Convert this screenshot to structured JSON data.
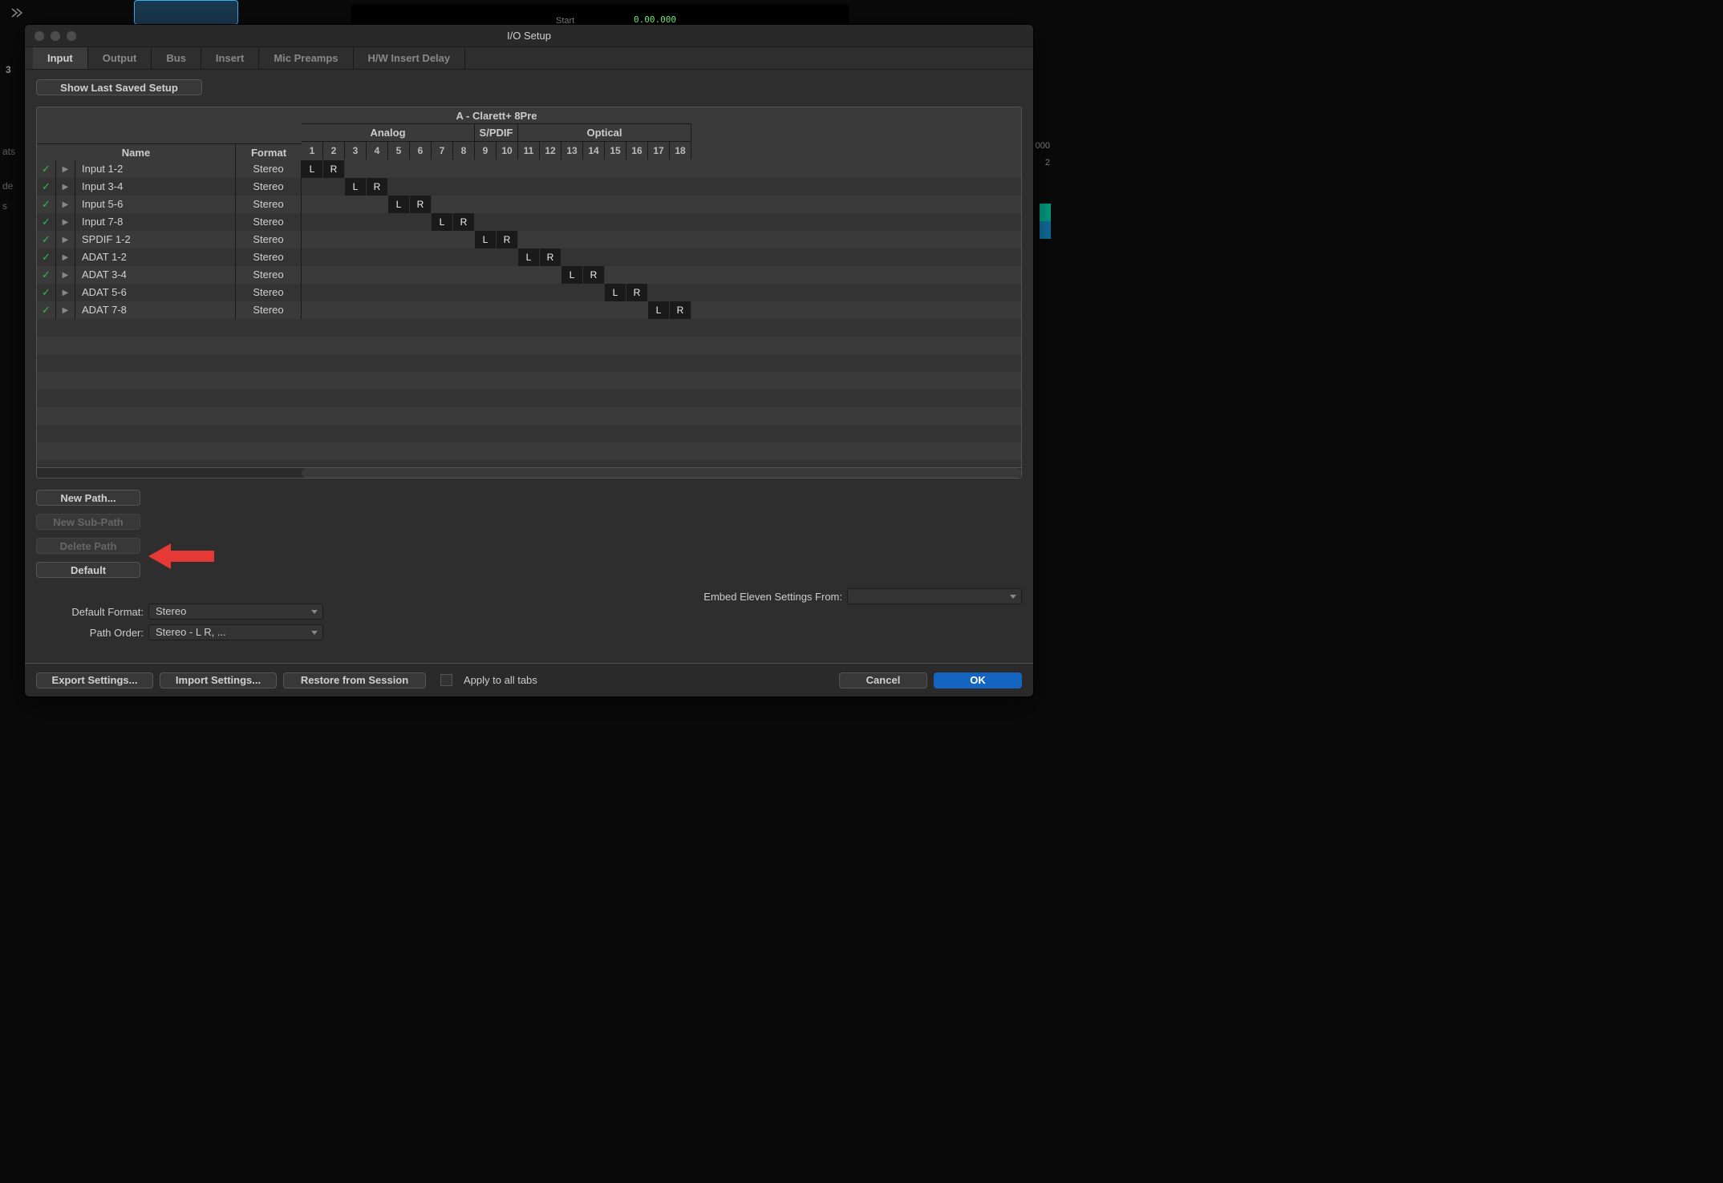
{
  "background": {
    "tab_number": "3",
    "sidebar1": "ats",
    "sidebar2": "de",
    "sidebar3": "s",
    "start": "Start",
    "right_text": "2",
    "counter1": "0.00.000",
    "right_zero": "000"
  },
  "modal": {
    "title": "I/O Setup",
    "tabs": [
      "Input",
      "Output",
      "Bus",
      "Insert",
      "Mic Preamps",
      "H/W Insert Delay"
    ],
    "active_tab": "Input",
    "show_last_saved": "Show Last Saved Setup",
    "device": "A - Clarett+ 8Pre",
    "sections": [
      {
        "label": "Analog",
        "span": 8
      },
      {
        "label": "S/PDIF",
        "span": 2
      },
      {
        "label": "Optical",
        "span": 8
      }
    ],
    "channels": [
      "1",
      "2",
      "3",
      "4",
      "5",
      "6",
      "7",
      "8",
      "9",
      "10",
      "11",
      "12",
      "13",
      "14",
      "15",
      "16",
      "17",
      "18"
    ],
    "columns": {
      "name": "Name",
      "format": "Format"
    },
    "rows": [
      {
        "checked": true,
        "name": "Input 1-2",
        "format": "Stereo",
        "L": 0,
        "R": 1
      },
      {
        "checked": true,
        "name": "Input 3-4",
        "format": "Stereo",
        "L": 2,
        "R": 3
      },
      {
        "checked": true,
        "name": "Input 5-6",
        "format": "Stereo",
        "L": 4,
        "R": 5
      },
      {
        "checked": true,
        "name": "Input 7-8",
        "format": "Stereo",
        "L": 6,
        "R": 7
      },
      {
        "checked": true,
        "name": "SPDIF 1-2",
        "format": "Stereo",
        "L": 8,
        "R": 9
      },
      {
        "checked": true,
        "name": "ADAT 1-2",
        "format": "Stereo",
        "L": 10,
        "R": 11
      },
      {
        "checked": true,
        "name": "ADAT 3-4",
        "format": "Stereo",
        "L": 12,
        "R": 13
      },
      {
        "checked": true,
        "name": "ADAT 5-6",
        "format": "Stereo",
        "L": 14,
        "R": 15
      },
      {
        "checked": true,
        "name": "ADAT 7-8",
        "format": "Stereo",
        "L": 16,
        "R": 17
      }
    ],
    "buttons": {
      "new_path": "New Path...",
      "new_subpath": "New Sub-Path",
      "delete_path": "Delete Path",
      "default": "Default",
      "export": "Export Settings...",
      "import": "Import Settings...",
      "restore": "Restore from Session",
      "apply_all": "Apply to all tabs",
      "cancel": "Cancel",
      "ok": "OK"
    },
    "default_format_label": "Default Format:",
    "default_format_value": "Stereo",
    "path_order_label": "Path Order:",
    "path_order_value": "Stereo - L R, ...",
    "embed_label": "Embed Eleven Settings From:",
    "embed_value": "",
    "lr_labels": {
      "L": "L",
      "R": "R"
    }
  }
}
